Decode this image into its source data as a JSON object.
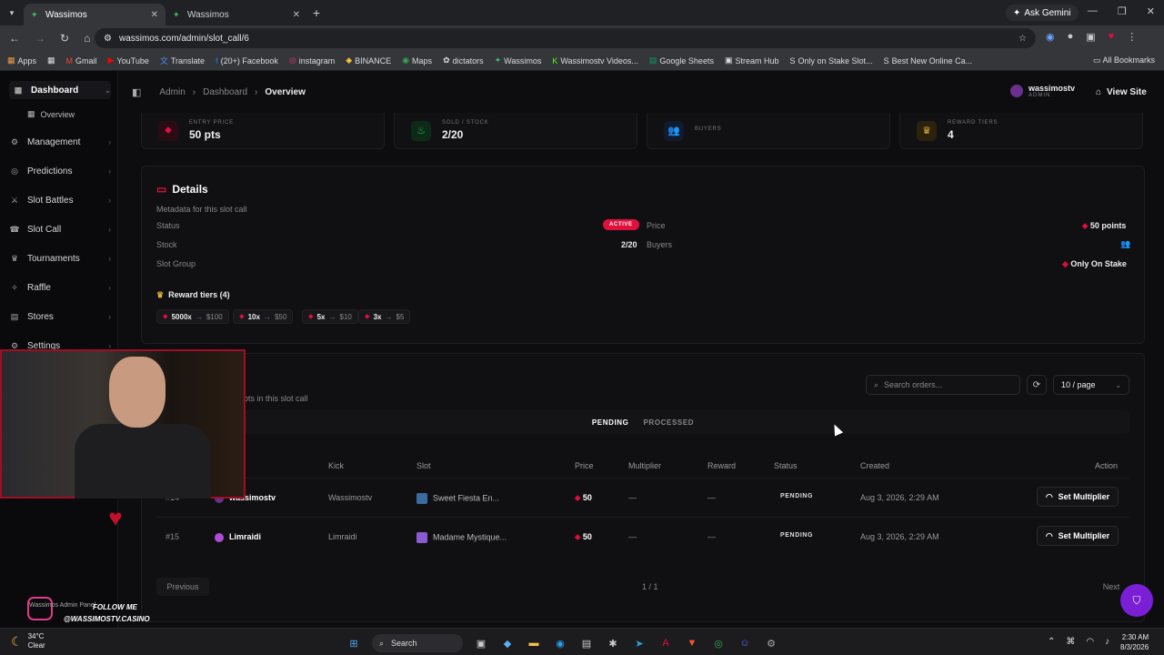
{
  "browser": {
    "tabs": [
      {
        "title": "Wassimos",
        "active": true
      },
      {
        "title": "Wassimos",
        "active": false
      }
    ],
    "ask_gemini": "Ask Gemini",
    "url": "wassimos.com/admin/slot_call/6",
    "bookmarks": [
      "Apps",
      "Gmail",
      "YouTube",
      "Translate",
      "(20+) Facebook",
      "instagram",
      "BINANCE",
      "Maps",
      "dictators",
      "Wassimos",
      "Wassimostv Videos...",
      "Google Sheets",
      "Stream Hub",
      "Only on Stake Slot...",
      "Best New Online Ca..."
    ],
    "all_bookmarks": "All Bookmarks"
  },
  "sidebar": {
    "items": [
      {
        "label": "Dashboard",
        "icon": "dashboard-icon"
      },
      {
        "label": "Management",
        "icon": "management-icon"
      },
      {
        "label": "Predictions",
        "icon": "predictions-icon"
      },
      {
        "label": "Slot Battles",
        "icon": "battles-icon"
      },
      {
        "label": "Slot Call",
        "icon": "slotcall-icon"
      },
      {
        "label": "Tournaments",
        "icon": "trophy-icon"
      },
      {
        "label": "Raffle",
        "icon": "raffle-icon"
      },
      {
        "label": "Stores",
        "icon": "store-icon"
      },
      {
        "label": "Settings",
        "icon": "gear-icon"
      }
    ],
    "sub_item": "Overview"
  },
  "topbar": {
    "crumbs": [
      "Admin",
      "Dashboard",
      "Overview"
    ],
    "user_name": "wassimostv",
    "user_role": "ADMIN",
    "view_site": "View Site"
  },
  "stats": [
    {
      "label": "ENTRY PRICE",
      "value": "50 pts",
      "color": "#e0103c"
    },
    {
      "label": "SOLD / STOCK",
      "value": "2/20",
      "color": "#2bbf6a"
    },
    {
      "label": "BUYERS",
      "value": "",
      "color": "#5a7de0"
    },
    {
      "label": "REWARD TIERS",
      "value": "4",
      "color": "#e0b23a"
    }
  ],
  "details": {
    "title": "Details",
    "subtitle": "Metadata for this slot call",
    "status_label": "Status",
    "status_value": "ACTIVE",
    "stock_label": "Stock",
    "stock_value": "2/20",
    "group_label": "Slot Group",
    "price_label": "Price",
    "price_value": "50 points",
    "buyers_label": "Buyers",
    "group_value": "Only On Stake",
    "reward_title": "Reward tiers (4)",
    "tiers": [
      {
        "mult": "5000x",
        "reward": "$100"
      },
      {
        "mult": "10x",
        "reward": "$50"
      },
      {
        "mult": "5x",
        "reward": "$10"
      },
      {
        "mult": "3x",
        "reward": "$5"
      }
    ]
  },
  "orders": {
    "subtitle": "lots in this slot call",
    "search_placeholder": "Search orders...",
    "per_page": "10 / page",
    "tabs": [
      "PENDING",
      "PROCESSED"
    ],
    "columns": [
      "Kick",
      "Slot",
      "Price",
      "Multiplier",
      "Reward",
      "Status",
      "Created",
      "Action"
    ],
    "rows": [
      {
        "id": "#14",
        "user": "wassimostv",
        "kick": "Wassimostv",
        "slot": "Sweet Fiesta En...",
        "price": "50",
        "multiplier": "—",
        "reward": "—",
        "status": "PENDING",
        "created": "Aug 3, 2026, 2:29 AM",
        "action": "Set Multiplier"
      },
      {
        "id": "#15",
        "user": "Limraidi",
        "kick": "Limraidi",
        "slot": "Madame Mystique...",
        "price": "50",
        "multiplier": "—",
        "reward": "—",
        "status": "PENDING",
        "created": "Aug 3, 2026, 2:29 AM",
        "action": "Set Multiplier"
      }
    ],
    "prev": "Previous",
    "page_info": "1 / 1",
    "next": "Next"
  },
  "overlay": {
    "follow_line1": "FOLLOW ME",
    "follow_line2": "@WASSIMOSTV.CASINO",
    "overlay_text": "Wassimos Admin Panel"
  },
  "taskbar": {
    "temp": "34°C",
    "weather": "Clear",
    "search": "Search",
    "time": "2:30 AM",
    "date": "8/3/2026"
  }
}
